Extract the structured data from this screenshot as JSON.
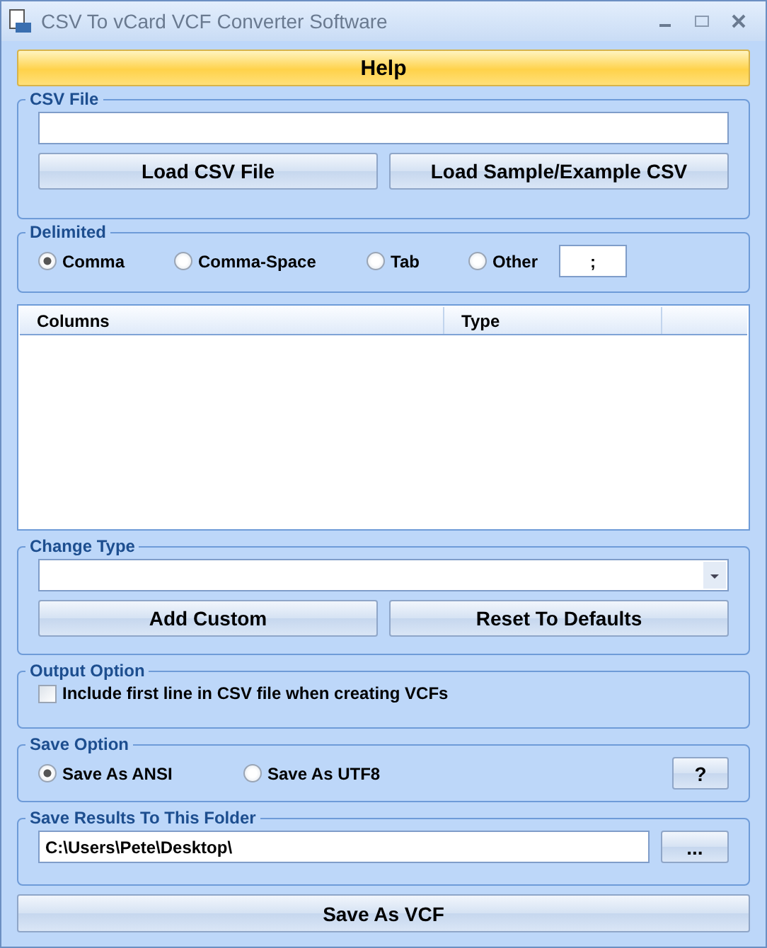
{
  "window": {
    "title": "CSV To vCard VCF Converter Software"
  },
  "help_button": "Help",
  "csv_file": {
    "label": "CSV File",
    "buttons": [
      "Load CSV File",
      "Load Sample/Example CSV"
    ]
  },
  "delimited": {
    "label": "Delimited",
    "options": [
      {
        "label": "Comma",
        "selected": true
      },
      {
        "label": "Comma-Space",
        "selected": false
      },
      {
        "label": "Tab",
        "selected": false
      },
      {
        "label": "Other",
        "selected": false
      }
    ],
    "other_value": ";"
  },
  "table": {
    "columns": [
      "Columns",
      "Type"
    ]
  },
  "change_type": {
    "label": "Change Type",
    "buttons": [
      "Add Custom",
      "Reset To Defaults"
    ]
  },
  "output_option": {
    "label": "Output Option",
    "checkbox": {
      "label": "Include first line in CSV file when creating VCFs",
      "checked": false
    }
  },
  "save_option": {
    "label": "Save Option",
    "options": [
      {
        "label": "Save As ANSI",
        "selected": true
      },
      {
        "label": "Save As UTF8",
        "selected": false
      }
    ],
    "help": "?"
  },
  "save_folder": {
    "label": "Save Results To This Folder",
    "value": "C:\\Users\\Pete\\Desktop\\",
    "browse": "..."
  },
  "save_button": "Save As VCF"
}
